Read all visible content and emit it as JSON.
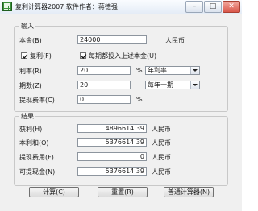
{
  "window": {
    "title": "复利计算器2007    软件作者：蒋德强",
    "min_glyph": "–",
    "max_glyph": "□",
    "close_glyph": "✕"
  },
  "input_group": {
    "title": "输入",
    "principal_label": "本金(B)",
    "principal_value": "24000",
    "principal_unit": "人民币",
    "compound_label": "复利(F)",
    "compound_checked": true,
    "reinvest_label": "每期都投入上述本金(U)",
    "reinvest_checked": true,
    "rate_label": "利率(R)",
    "rate_value": "20",
    "rate_unit": "%",
    "rate_type_selected": "年利率",
    "periods_label": "期数(Z)",
    "periods_value": "20",
    "period_type_selected": "每年一期",
    "withdraw_rate_label": "提现费率(C)",
    "withdraw_rate_value": "0",
    "withdraw_rate_unit": "%"
  },
  "result_group": {
    "title": "结果",
    "profit_label": "获利(H)",
    "profit_value": "4896614.39",
    "profit_unit": "人民币",
    "total_label": "本利和(O)",
    "total_value": "5376614.39",
    "total_unit": "人民币",
    "fee_label": "提现费用(F)",
    "fee_value": "0",
    "fee_unit": "人民币",
    "withdrawable_label": "可提现金(N)",
    "withdrawable_value": "5376614.39",
    "withdrawable_unit": "人民币"
  },
  "buttons": {
    "calculate": "计算(C)",
    "reset": "重置(R)",
    "normal_calc": "普通计算器(N)"
  }
}
